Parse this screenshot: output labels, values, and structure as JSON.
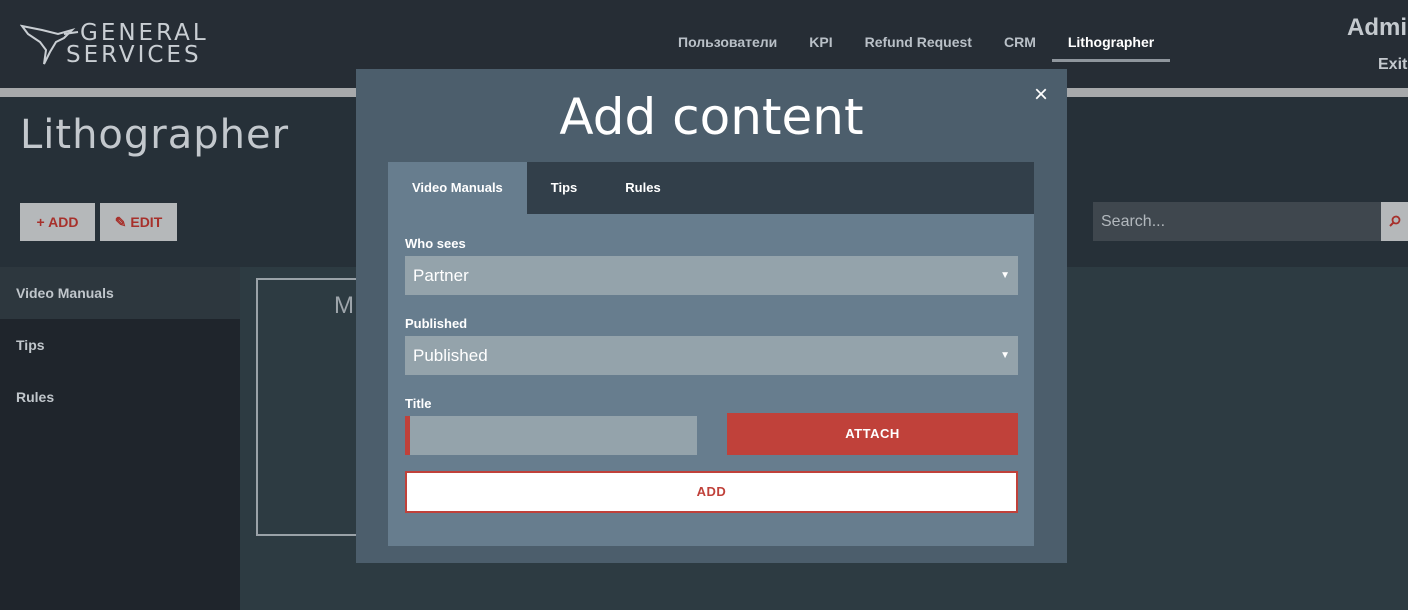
{
  "header": {
    "logo": {
      "line1": "GENERAL",
      "line2": "SERVICES"
    },
    "nav": [
      {
        "label": "Пользователи"
      },
      {
        "label": "KPI"
      },
      {
        "label": "Refund Request"
      },
      {
        "label": "CRM"
      },
      {
        "label": "Lithographer",
        "active": true
      }
    ],
    "user_name": "Admi",
    "exit_label": "Exit"
  },
  "page": {
    "title": "Lithographer",
    "add_label": "+ ADD",
    "edit_label": "✎ EDIT",
    "search_placeholder": "Search...",
    "search_icon": "search-icon"
  },
  "sidebar": {
    "items": [
      {
        "label": "Video Manuals",
        "active": true
      },
      {
        "label": "Tips"
      },
      {
        "label": "Rules"
      }
    ]
  },
  "content": {
    "card_letter": "M"
  },
  "modal": {
    "title": "Add content",
    "close_icon": "×",
    "tabs": [
      {
        "label": "Video Manuals",
        "active": true
      },
      {
        "label": "Tips"
      },
      {
        "label": "Rules"
      }
    ],
    "who_sees": {
      "label": "Who sees",
      "value": "Partner"
    },
    "published": {
      "label": "Published",
      "value": "Published"
    },
    "title_field": {
      "label": "Title",
      "value": ""
    },
    "attach_label": "ATTACH",
    "add_label": "ADD",
    "colors": {
      "accent": "#c0413a",
      "modal_bg": "#4c5e6c",
      "inner_bg": "#677d8e"
    }
  }
}
